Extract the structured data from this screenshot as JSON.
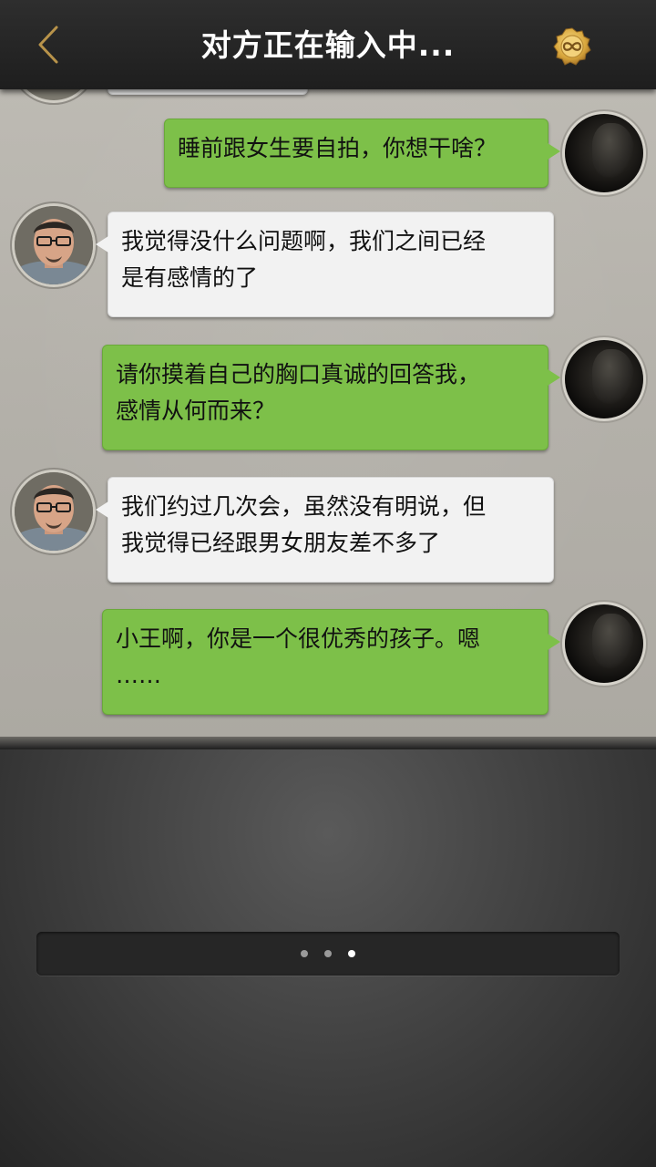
{
  "header": {
    "title": "对方正在输入中...",
    "back_icon": "chevron-left-icon",
    "coin_icon": "infinity-coin-icon",
    "accent_color": "#b8934a"
  },
  "messages": [
    {
      "from": "me",
      "lines": [
        "睡前跟女生要自拍，你想干啥？"
      ]
    },
    {
      "from": "them",
      "lines": [
        "我觉得没什么问题啊，我们之间已经",
        "是有感情的了"
      ]
    },
    {
      "from": "me",
      "lines": [
        "请你摸着自己的胸口真诚的回答我，",
        "感情从何而来？"
      ]
    },
    {
      "from": "them",
      "lines": [
        "我们约过几次会，虽然没有明说，但",
        "我觉得已经跟男女朋友差不多了"
      ]
    },
    {
      "from": "me",
      "lines": [
        "小王啊，你是一个很优秀的孩子。嗯",
        "……"
      ]
    }
  ],
  "typing_indicator": {
    "dots": 3,
    "active_dot": 3
  },
  "colors": {
    "my_bubble": "#7dc049",
    "their_bubble": "#f2f2f2"
  }
}
